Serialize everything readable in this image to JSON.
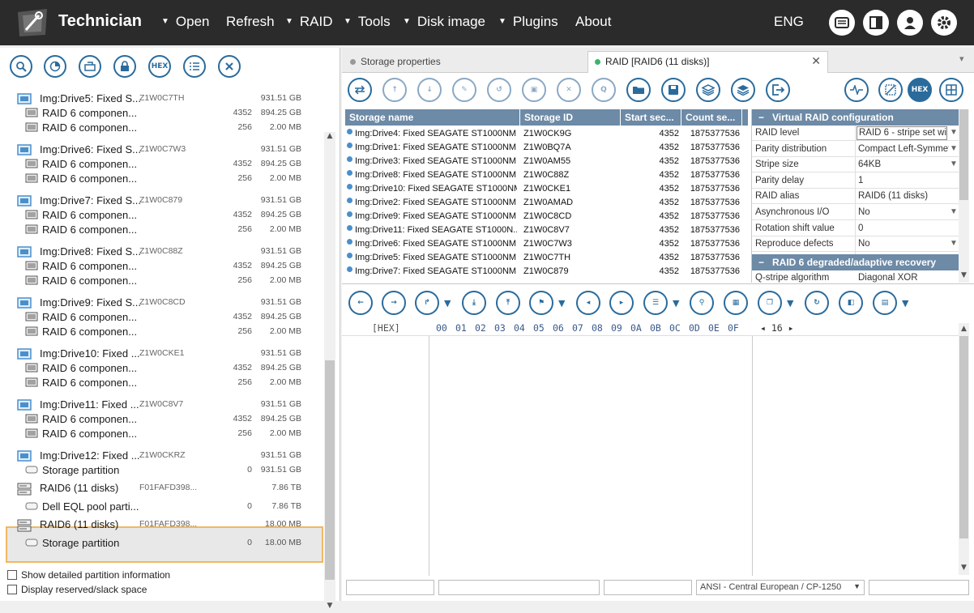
{
  "app": {
    "title": "Technician"
  },
  "menu": [
    {
      "label": "Open",
      "caret": true
    },
    {
      "label": "Refresh",
      "caret": false
    },
    {
      "label": "RAID",
      "caret": true
    },
    {
      "label": "Tools",
      "caret": true
    },
    {
      "label": "Disk image",
      "caret": true
    },
    {
      "label": "Plugins",
      "caret": true
    },
    {
      "label": "About",
      "caret": false
    }
  ],
  "lang": "ENG",
  "left_toolbar": {
    "hex_label": "HEX"
  },
  "tree": [
    {
      "type": "drive",
      "name": "Img:Drive5: Fixed S...",
      "id": "Z1W0C7TH",
      "start": "",
      "size": "931.51 GB"
    },
    {
      "type": "comp",
      "name": "RAID 6 componen...",
      "id": "",
      "start": "4352",
      "size": "894.25 GB"
    },
    {
      "type": "comp",
      "name": "RAID 6 componen...",
      "id": "",
      "start": "256",
      "size": "2.00 MB"
    },
    {
      "type": "drive",
      "name": "Img:Drive6: Fixed S...",
      "id": "Z1W0C7W3",
      "start": "",
      "size": "931.51 GB"
    },
    {
      "type": "comp",
      "name": "RAID 6 componen...",
      "id": "",
      "start": "4352",
      "size": "894.25 GB"
    },
    {
      "type": "comp",
      "name": "RAID 6 componen...",
      "id": "",
      "start": "256",
      "size": "2.00 MB"
    },
    {
      "type": "drive",
      "name": "Img:Drive7: Fixed S...",
      "id": "Z1W0C879",
      "start": "",
      "size": "931.51 GB"
    },
    {
      "type": "comp",
      "name": "RAID 6 componen...",
      "id": "",
      "start": "4352",
      "size": "894.25 GB"
    },
    {
      "type": "comp",
      "name": "RAID 6 componen...",
      "id": "",
      "start": "256",
      "size": "2.00 MB"
    },
    {
      "type": "drive",
      "name": "Img:Drive8: Fixed S...",
      "id": "Z1W0C88Z",
      "start": "",
      "size": "931.51 GB"
    },
    {
      "type": "comp",
      "name": "RAID 6 componen...",
      "id": "",
      "start": "4352",
      "size": "894.25 GB"
    },
    {
      "type": "comp",
      "name": "RAID 6 componen...",
      "id": "",
      "start": "256",
      "size": "2.00 MB"
    },
    {
      "type": "drive",
      "name": "Img:Drive9: Fixed S...",
      "id": "Z1W0C8CD",
      "start": "",
      "size": "931.51 GB"
    },
    {
      "type": "comp",
      "name": "RAID 6 componen...",
      "id": "",
      "start": "4352",
      "size": "894.25 GB"
    },
    {
      "type": "comp",
      "name": "RAID 6 componen...",
      "id": "",
      "start": "256",
      "size": "2.00 MB"
    },
    {
      "type": "drive",
      "name": "Img:Drive10: Fixed ...",
      "id": "Z1W0CKE1",
      "start": "",
      "size": "931.51 GB"
    },
    {
      "type": "comp",
      "name": "RAID 6 componen...",
      "id": "",
      "start": "4352",
      "size": "894.25 GB"
    },
    {
      "type": "comp",
      "name": "RAID 6 componen...",
      "id": "",
      "start": "256",
      "size": "2.00 MB"
    },
    {
      "type": "drive",
      "name": "Img:Drive11: Fixed ...",
      "id": "Z1W0C8V7",
      "start": "",
      "size": "931.51 GB"
    },
    {
      "type": "comp",
      "name": "RAID 6 componen...",
      "id": "",
      "start": "4352",
      "size": "894.25 GB"
    },
    {
      "type": "comp",
      "name": "RAID 6 componen...",
      "id": "",
      "start": "256",
      "size": "2.00 MB"
    },
    {
      "type": "drive",
      "name": "Img:Drive12: Fixed ...",
      "id": "Z1W0CKRZ",
      "start": "",
      "size": "931.51 GB"
    },
    {
      "type": "part",
      "name": "Storage partition",
      "id": "",
      "start": "0",
      "size": "931.51 GB"
    },
    {
      "type": "raid",
      "name": "RAID6 (11 disks)",
      "id": "F01FAFD398...",
      "start": "",
      "size": "7.86 TB"
    },
    {
      "type": "part",
      "name": "Dell EQL pool parti...",
      "id": "",
      "start": "0",
      "size": "7.86 TB"
    },
    {
      "type": "raid",
      "name": "RAID6 (11 disks)",
      "id": "F01FAFD398...",
      "start": "",
      "size": "18.00 MB"
    },
    {
      "type": "part",
      "name": "Storage partition",
      "id": "",
      "start": "0",
      "size": "18.00 MB"
    }
  ],
  "checkboxes": [
    "Show detailed partition information",
    "Display reserved/slack space"
  ],
  "tabs": [
    {
      "label": "Storage properties",
      "active": false,
      "dot_color": "#999999"
    },
    {
      "label": "RAID [RAID6 (11 disks)]",
      "active": true,
      "dot_color": "#3cb371"
    }
  ],
  "right_toolbar": {
    "q_label": "Q",
    "hex_label": "HEX"
  },
  "storage_table": {
    "headers": [
      "Storage name",
      "Storage ID",
      "Start sec...",
      "Count se..."
    ],
    "rows": [
      [
        "Img:Drive4: Fixed SEAGATE ST1000NM...",
        "Z1W0CK9G",
        "4352",
        "1875377536"
      ],
      [
        "Img:Drive1: Fixed SEAGATE ST1000NM...",
        "Z1W0BQ7A",
        "4352",
        "1875377536"
      ],
      [
        "Img:Drive3: Fixed SEAGATE ST1000NM...",
        "Z1W0AM55",
        "4352",
        "1875377536"
      ],
      [
        "Img:Drive8: Fixed SEAGATE ST1000NM...",
        "Z1W0C88Z",
        "4352",
        "1875377536"
      ],
      [
        "Img:Drive10: Fixed SEAGATE ST1000NM...",
        "Z1W0CKE1",
        "4352",
        "1875377536"
      ],
      [
        "Img:Drive2: Fixed SEAGATE ST1000NM...",
        "Z1W0AMAD",
        "4352",
        "1875377536"
      ],
      [
        "Img:Drive9: Fixed SEAGATE ST1000NM...",
        "Z1W0C8CD",
        "4352",
        "1875377536"
      ],
      [
        "Img:Drive11: Fixed SEAGATE ST1000N...",
        "Z1W0C8V7",
        "4352",
        "1875377536"
      ],
      [
        "Img:Drive6: Fixed SEAGATE ST1000NM...",
        "Z1W0C7W3",
        "4352",
        "1875377536"
      ],
      [
        "Img:Drive5: Fixed SEAGATE ST1000NM...",
        "Z1W0C7TH",
        "4352",
        "1875377536"
      ],
      [
        "Img:Drive7: Fixed SEAGATE ST1000NM...",
        "Z1W0C879",
        "4352",
        "1875377536"
      ]
    ]
  },
  "props": {
    "section1": "Virtual RAID configuration",
    "rows": [
      {
        "k": "RAID level",
        "v": "RAID 6 - stripe set wit",
        "dd": true
      },
      {
        "k": "Parity distribution",
        "v": "Compact Left-Symmet",
        "dd": true
      },
      {
        "k": "Stripe size",
        "v": "64KB",
        "dd": true
      },
      {
        "k": "Parity delay",
        "v": "1",
        "dd": false
      },
      {
        "k": "RAID alias",
        "v": "RAID6 (11 disks)",
        "dd": false
      },
      {
        "k": "Asynchronous I/O",
        "v": "No",
        "dd": true
      },
      {
        "k": "Rotation shift value",
        "v": "0",
        "dd": false
      },
      {
        "k": "Reproduce defects",
        "v": "No",
        "dd": true
      }
    ],
    "section2": "RAID 6 degraded/adaptive recovery",
    "rows2": [
      {
        "k": "Q-stripe algorithm",
        "v": "Diagonal XOR",
        "dd": false
      }
    ]
  },
  "hex": {
    "label": "[HEX]",
    "columns": [
      "00",
      "01",
      "02",
      "03",
      "04",
      "05",
      "06",
      "07",
      "08",
      "09",
      "0A",
      "0B",
      "0C",
      "0D",
      "0E",
      "0F"
    ],
    "width": "16"
  },
  "status": {
    "encoding": "ANSI - Central European / CP-1250"
  }
}
